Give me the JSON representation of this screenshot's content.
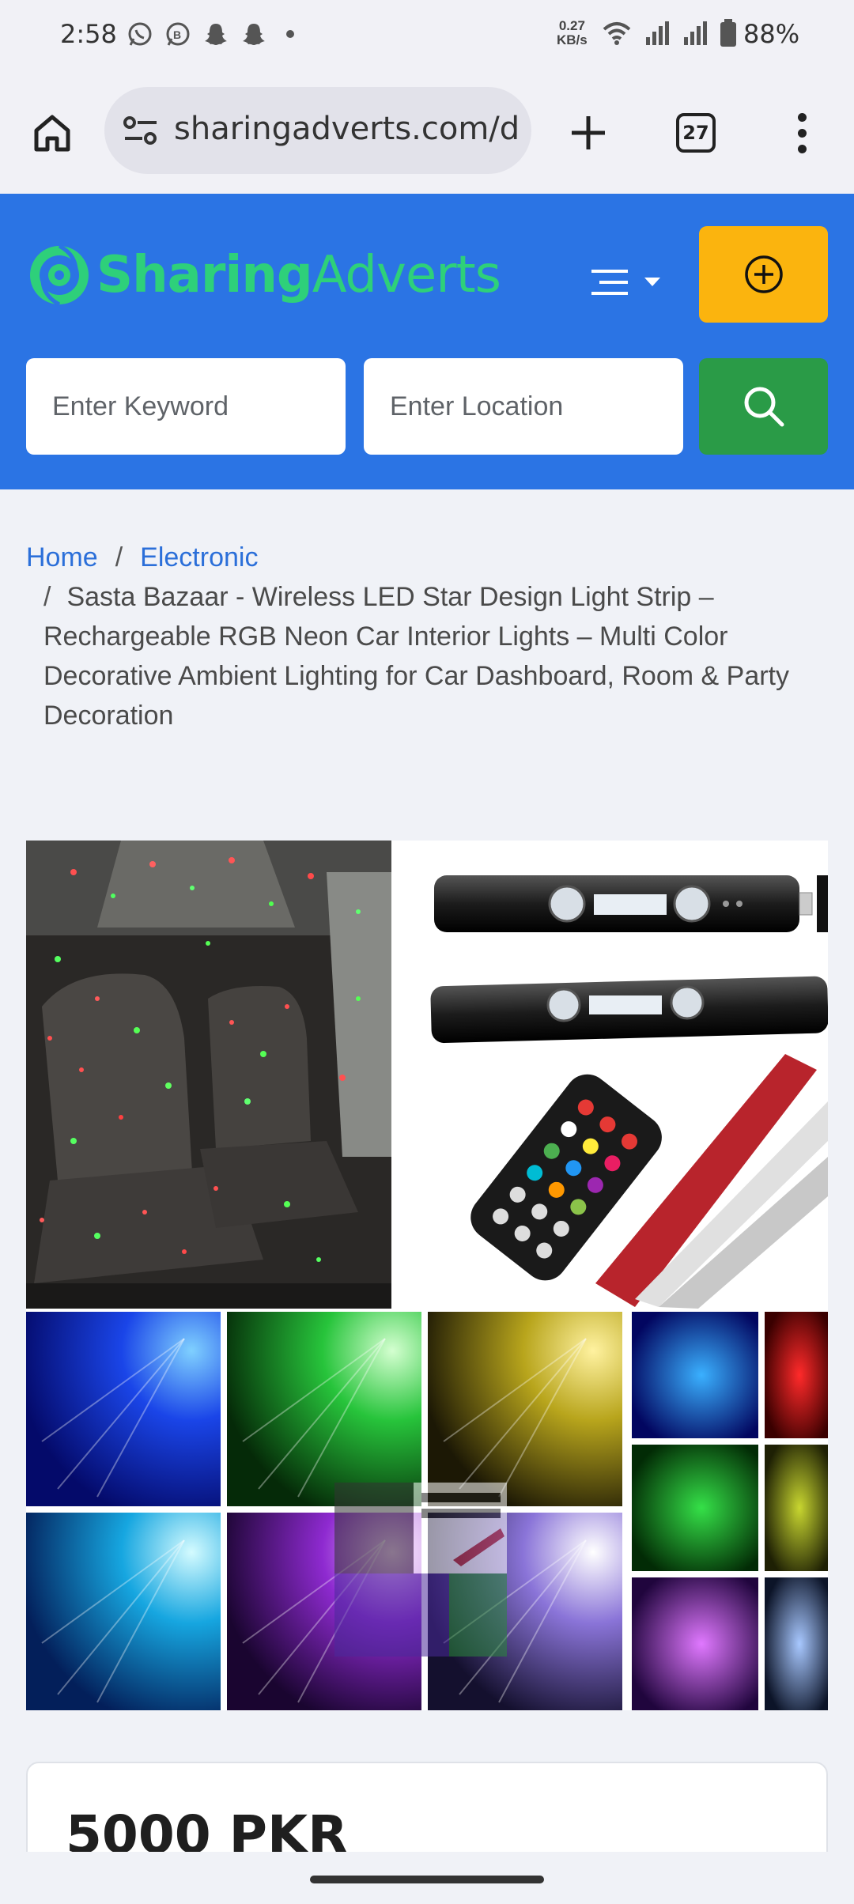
{
  "status_bar": {
    "time": "2:58",
    "net_speed_value": "0.27",
    "net_speed_unit": "KB/s",
    "battery_percent": "88%"
  },
  "browser": {
    "url": "sharingadverts.com/d",
    "tab_count": "27"
  },
  "header": {
    "logo_bold": "Sharing",
    "logo_light": "Adverts",
    "brand_green": "#2ed07a",
    "header_bg": "#2b74e4",
    "post_button_color": "#fbb40e",
    "search_button_color": "#2a9b47"
  },
  "search": {
    "keyword_placeholder": "Enter Keyword",
    "location_placeholder": "Enter Location"
  },
  "breadcrumb": {
    "home": "Home",
    "separator": "/",
    "category": "Electronic",
    "current": "Sasta Bazaar - Wireless LED Star Design Light Strip – Rechargeable RGB Neon Car Interior Lights – Multi Color Decorative Ambient Lighting for Car Dashboard, Room & Party Decoration"
  },
  "product": {
    "price": "5000 PKR"
  }
}
